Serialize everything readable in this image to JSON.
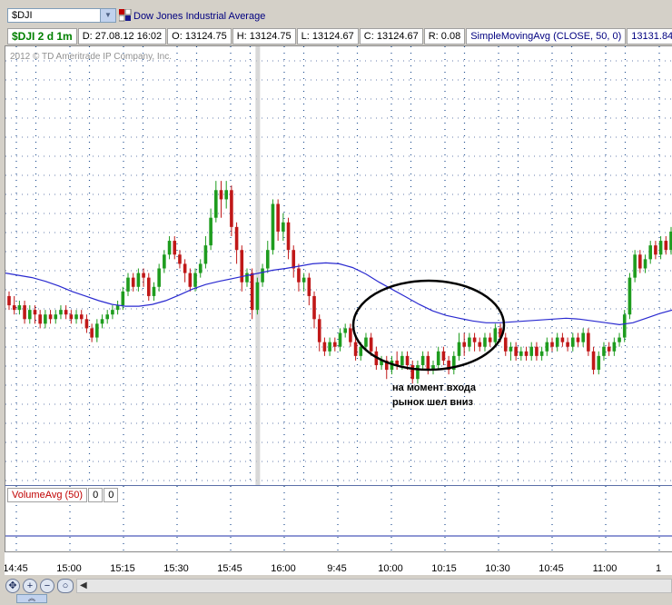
{
  "toolbar": {
    "symbol": "$DJI",
    "description": "Dow Jones Industrial Average"
  },
  "infobar": {
    "symbol_period": "$DJI 2 d 1m",
    "date": "D: 27.08.12 16:02",
    "open": "O: 13124.75",
    "high": "H: 13124.75",
    "low": "L: 13124.67",
    "close": "C: 13124.67",
    "range": "R: 0.08",
    "study_name": "SimpleMovingAvg (CLOSE, 50, 0)",
    "study_value": "13131.84"
  },
  "copyright": "2012 © TD Ameritrade IP Company, Inc.",
  "annotation": {
    "line1": "на момент входа",
    "line2": "рынок шел вниз"
  },
  "volume_panel": {
    "label": "VolumeAvg (50)",
    "v1": "0",
    "v2": "0"
  },
  "colors": {
    "up": "#1e9c1e",
    "down": "#c01818",
    "sma": "#2a2ad0",
    "grid": "#1f4e8f"
  },
  "chart_data": {
    "type": "candlestick",
    "series": [
      {
        "name": "$DJI 2 d 1m",
        "type": "candlestick"
      },
      {
        "name": "SimpleMovingAvg (CLOSE, 50, 0)",
        "type": "line"
      }
    ],
    "x_ticks": [
      "14:45",
      "15:00",
      "15:15",
      "15:30",
      "15:45",
      "16:00",
      "9:45",
      "10:00",
      "10:15",
      "10:30",
      "10:45",
      "11:00",
      "1"
    ],
    "candles": [
      {
        "o": 0.43,
        "c": 0.41,
        "h": 0.44,
        "l": 0.4
      },
      {
        "o": 0.41,
        "c": 0.4,
        "h": 0.43,
        "l": 0.39
      },
      {
        "o": 0.4,
        "c": 0.41,
        "h": 0.42,
        "l": 0.39
      },
      {
        "o": 0.41,
        "c": 0.38,
        "h": 0.42,
        "l": 0.37
      },
      {
        "o": 0.38,
        "c": 0.4,
        "h": 0.41,
        "l": 0.37
      },
      {
        "o": 0.4,
        "c": 0.39,
        "h": 0.41,
        "l": 0.37
      },
      {
        "o": 0.39,
        "c": 0.37,
        "h": 0.4,
        "l": 0.36
      },
      {
        "o": 0.37,
        "c": 0.39,
        "h": 0.4,
        "l": 0.36
      },
      {
        "o": 0.39,
        "c": 0.38,
        "h": 0.4,
        "l": 0.37
      },
      {
        "o": 0.38,
        "c": 0.39,
        "h": 0.4,
        "l": 0.37
      },
      {
        "o": 0.39,
        "c": 0.4,
        "h": 0.41,
        "l": 0.38
      },
      {
        "o": 0.4,
        "c": 0.39,
        "h": 0.41,
        "l": 0.38
      },
      {
        "o": 0.39,
        "c": 0.38,
        "h": 0.4,
        "l": 0.37
      },
      {
        "o": 0.38,
        "c": 0.39,
        "h": 0.4,
        "l": 0.37
      },
      {
        "o": 0.39,
        "c": 0.38,
        "h": 0.4,
        "l": 0.37
      },
      {
        "o": 0.38,
        "c": 0.36,
        "h": 0.39,
        "l": 0.35
      },
      {
        "o": 0.36,
        "c": 0.34,
        "h": 0.37,
        "l": 0.33
      },
      {
        "o": 0.34,
        "c": 0.37,
        "h": 0.38,
        "l": 0.33
      },
      {
        "o": 0.37,
        "c": 0.38,
        "h": 0.39,
        "l": 0.36
      },
      {
        "o": 0.38,
        "c": 0.39,
        "h": 0.4,
        "l": 0.37
      },
      {
        "o": 0.39,
        "c": 0.4,
        "h": 0.41,
        "l": 0.38
      },
      {
        "o": 0.4,
        "c": 0.41,
        "h": 0.42,
        "l": 0.39
      },
      {
        "o": 0.41,
        "c": 0.44,
        "h": 0.45,
        "l": 0.4
      },
      {
        "o": 0.44,
        "c": 0.47,
        "h": 0.48,
        "l": 0.43
      },
      {
        "o": 0.47,
        "c": 0.45,
        "h": 0.48,
        "l": 0.44
      },
      {
        "o": 0.45,
        "c": 0.48,
        "h": 0.49,
        "l": 0.44
      },
      {
        "o": 0.48,
        "c": 0.47,
        "h": 0.49,
        "l": 0.45
      },
      {
        "o": 0.47,
        "c": 0.43,
        "h": 0.48,
        "l": 0.42
      },
      {
        "o": 0.43,
        "c": 0.45,
        "h": 0.46,
        "l": 0.42
      },
      {
        "o": 0.45,
        "c": 0.49,
        "h": 0.5,
        "l": 0.44
      },
      {
        "o": 0.49,
        "c": 0.52,
        "h": 0.53,
        "l": 0.48
      },
      {
        "o": 0.52,
        "c": 0.55,
        "h": 0.56,
        "l": 0.51
      },
      {
        "o": 0.55,
        "c": 0.52,
        "h": 0.56,
        "l": 0.51
      },
      {
        "o": 0.52,
        "c": 0.5,
        "h": 0.53,
        "l": 0.49
      },
      {
        "o": 0.5,
        "c": 0.48,
        "h": 0.51,
        "l": 0.46
      },
      {
        "o": 0.48,
        "c": 0.45,
        "h": 0.49,
        "l": 0.44
      },
      {
        "o": 0.45,
        "c": 0.48,
        "h": 0.49,
        "l": 0.44
      },
      {
        "o": 0.48,
        "c": 0.5,
        "h": 0.51,
        "l": 0.47
      },
      {
        "o": 0.5,
        "c": 0.54,
        "h": 0.56,
        "l": 0.49
      },
      {
        "o": 0.54,
        "c": 0.6,
        "h": 0.62,
        "l": 0.53
      },
      {
        "o": 0.6,
        "c": 0.66,
        "h": 0.68,
        "l": 0.59
      },
      {
        "o": 0.66,
        "c": 0.64,
        "h": 0.68,
        "l": 0.6
      },
      {
        "o": 0.64,
        "c": 0.66,
        "h": 0.68,
        "l": 0.62
      },
      {
        "o": 0.66,
        "c": 0.58,
        "h": 0.67,
        "l": 0.56
      },
      {
        "o": 0.58,
        "c": 0.53,
        "h": 0.59,
        "l": 0.5
      },
      {
        "o": 0.53,
        "c": 0.46,
        "h": 0.54,
        "l": 0.44
      },
      {
        "o": 0.46,
        "c": 0.48,
        "h": 0.49,
        "l": 0.45
      },
      {
        "o": 0.48,
        "c": 0.4,
        "h": 0.49,
        "l": 0.38
      },
      {
        "o": 0.4,
        "c": 0.46,
        "h": 0.47,
        "l": 0.39
      },
      {
        "o": 0.46,
        "c": 0.49,
        "h": 0.5,
        "l": 0.45
      },
      {
        "o": 0.49,
        "c": 0.53,
        "h": 0.55,
        "l": 0.48
      },
      {
        "o": 0.53,
        "c": 0.63,
        "h": 0.64,
        "l": 0.52
      },
      {
        "o": 0.63,
        "c": 0.57,
        "h": 0.64,
        "l": 0.55
      },
      {
        "o": 0.57,
        "c": 0.59,
        "h": 0.61,
        "l": 0.55
      },
      {
        "o": 0.59,
        "c": 0.53,
        "h": 0.6,
        "l": 0.51
      },
      {
        "o": 0.53,
        "c": 0.49,
        "h": 0.54,
        "l": 0.47
      },
      {
        "o": 0.49,
        "c": 0.46,
        "h": 0.5,
        "l": 0.44
      },
      {
        "o": 0.46,
        "c": 0.47,
        "h": 0.48,
        "l": 0.44
      },
      {
        "o": 0.47,
        "c": 0.43,
        "h": 0.48,
        "l": 0.41
      },
      {
        "o": 0.43,
        "c": 0.38,
        "h": 0.44,
        "l": 0.36
      },
      {
        "o": 0.38,
        "c": 0.33,
        "h": 0.39,
        "l": 0.31
      },
      {
        "o": 0.33,
        "c": 0.31,
        "h": 0.34,
        "l": 0.3
      },
      {
        "o": 0.31,
        "c": 0.33,
        "h": 0.34,
        "l": 0.3
      },
      {
        "o": 0.33,
        "c": 0.32,
        "h": 0.34,
        "l": 0.31
      },
      {
        "o": 0.32,
        "c": 0.35,
        "h": 0.36,
        "l": 0.31
      },
      {
        "o": 0.35,
        "c": 0.36,
        "h": 0.37,
        "l": 0.34
      },
      {
        "o": 0.36,
        "c": 0.33,
        "h": 0.37,
        "l": 0.32
      },
      {
        "o": 0.33,
        "c": 0.3,
        "h": 0.34,
        "l": 0.29
      },
      {
        "o": 0.3,
        "c": 0.32,
        "h": 0.33,
        "l": 0.29
      },
      {
        "o": 0.32,
        "c": 0.34,
        "h": 0.35,
        "l": 0.31
      },
      {
        "o": 0.34,
        "c": 0.31,
        "h": 0.35,
        "l": 0.3
      },
      {
        "o": 0.31,
        "c": 0.28,
        "h": 0.32,
        "l": 0.27
      },
      {
        "o": 0.28,
        "c": 0.29,
        "h": 0.3,
        "l": 0.27
      },
      {
        "o": 0.29,
        "c": 0.27,
        "h": 0.3,
        "l": 0.25
      },
      {
        "o": 0.27,
        "c": 0.29,
        "h": 0.3,
        "l": 0.26
      },
      {
        "o": 0.29,
        "c": 0.28,
        "h": 0.31,
        "l": 0.27
      },
      {
        "o": 0.28,
        "c": 0.3,
        "h": 0.31,
        "l": 0.27
      },
      {
        "o": 0.3,
        "c": 0.28,
        "h": 0.31,
        "l": 0.27
      },
      {
        "o": 0.28,
        "c": 0.25,
        "h": 0.29,
        "l": 0.24
      },
      {
        "o": 0.25,
        "c": 0.28,
        "h": 0.29,
        "l": 0.24
      },
      {
        "o": 0.28,
        "c": 0.3,
        "h": 0.31,
        "l": 0.27
      },
      {
        "o": 0.3,
        "c": 0.27,
        "h": 0.31,
        "l": 0.26
      },
      {
        "o": 0.27,
        "c": 0.28,
        "h": 0.29,
        "l": 0.26
      },
      {
        "o": 0.28,
        "c": 0.31,
        "h": 0.32,
        "l": 0.27
      },
      {
        "o": 0.31,
        "c": 0.29,
        "h": 0.32,
        "l": 0.28
      },
      {
        "o": 0.29,
        "c": 0.27,
        "h": 0.3,
        "l": 0.26
      },
      {
        "o": 0.27,
        "c": 0.3,
        "h": 0.31,
        "l": 0.26
      },
      {
        "o": 0.3,
        "c": 0.33,
        "h": 0.35,
        "l": 0.29
      },
      {
        "o": 0.33,
        "c": 0.32,
        "h": 0.35,
        "l": 0.3
      },
      {
        "o": 0.32,
        "c": 0.34,
        "h": 0.35,
        "l": 0.31
      },
      {
        "o": 0.34,
        "c": 0.33,
        "h": 0.35,
        "l": 0.31
      },
      {
        "o": 0.33,
        "c": 0.32,
        "h": 0.34,
        "l": 0.31
      },
      {
        "o": 0.32,
        "c": 0.34,
        "h": 0.35,
        "l": 0.31
      },
      {
        "o": 0.34,
        "c": 0.33,
        "h": 0.35,
        "l": 0.32
      },
      {
        "o": 0.33,
        "c": 0.36,
        "h": 0.37,
        "l": 0.32
      },
      {
        "o": 0.36,
        "c": 0.34,
        "h": 0.37,
        "l": 0.33
      },
      {
        "o": 0.34,
        "c": 0.31,
        "h": 0.35,
        "l": 0.3
      },
      {
        "o": 0.31,
        "c": 0.32,
        "h": 0.33,
        "l": 0.29
      },
      {
        "o": 0.32,
        "c": 0.3,
        "h": 0.33,
        "l": 0.29
      },
      {
        "o": 0.3,
        "c": 0.31,
        "h": 0.32,
        "l": 0.29
      },
      {
        "o": 0.31,
        "c": 0.3,
        "h": 0.32,
        "l": 0.29
      },
      {
        "o": 0.3,
        "c": 0.32,
        "h": 0.33,
        "l": 0.29
      },
      {
        "o": 0.32,
        "c": 0.3,
        "h": 0.33,
        "l": 0.29
      },
      {
        "o": 0.3,
        "c": 0.31,
        "h": 0.32,
        "l": 0.29
      },
      {
        "o": 0.31,
        "c": 0.33,
        "h": 0.34,
        "l": 0.3
      },
      {
        "o": 0.33,
        "c": 0.32,
        "h": 0.34,
        "l": 0.31
      },
      {
        "o": 0.32,
        "c": 0.34,
        "h": 0.35,
        "l": 0.31
      },
      {
        "o": 0.34,
        "c": 0.33,
        "h": 0.35,
        "l": 0.32
      },
      {
        "o": 0.33,
        "c": 0.32,
        "h": 0.34,
        "l": 0.31
      },
      {
        "o": 0.32,
        "c": 0.34,
        "h": 0.35,
        "l": 0.31
      },
      {
        "o": 0.34,
        "c": 0.33,
        "h": 0.35,
        "l": 0.32
      },
      {
        "o": 0.33,
        "c": 0.35,
        "h": 0.36,
        "l": 0.32
      },
      {
        "o": 0.35,
        "c": 0.31,
        "h": 0.36,
        "l": 0.3
      },
      {
        "o": 0.31,
        "c": 0.27,
        "h": 0.32,
        "l": 0.26
      },
      {
        "o": 0.27,
        "c": 0.3,
        "h": 0.31,
        "l": 0.26
      },
      {
        "o": 0.3,
        "c": 0.32,
        "h": 0.33,
        "l": 0.29
      },
      {
        "o": 0.32,
        "c": 0.31,
        "h": 0.33,
        "l": 0.3
      },
      {
        "o": 0.31,
        "c": 0.33,
        "h": 0.34,
        "l": 0.3
      },
      {
        "o": 0.33,
        "c": 0.34,
        "h": 0.35,
        "l": 0.32
      },
      {
        "o": 0.34,
        "c": 0.39,
        "h": 0.4,
        "l": 0.33
      },
      {
        "o": 0.39,
        "c": 0.47,
        "h": 0.48,
        "l": 0.38
      },
      {
        "o": 0.47,
        "c": 0.52,
        "h": 0.53,
        "l": 0.46
      },
      {
        "o": 0.52,
        "c": 0.49,
        "h": 0.53,
        "l": 0.48
      },
      {
        "o": 0.49,
        "c": 0.51,
        "h": 0.52,
        "l": 0.48
      },
      {
        "o": 0.51,
        "c": 0.54,
        "h": 0.55,
        "l": 0.5
      },
      {
        "o": 0.54,
        "c": 0.52,
        "h": 0.55,
        "l": 0.51
      },
      {
        "o": 0.52,
        "c": 0.55,
        "h": 0.56,
        "l": 0.51
      },
      {
        "o": 0.55,
        "c": 0.53,
        "h": 0.56,
        "l": 0.52
      },
      {
        "o": 0.53,
        "c": 0.57,
        "h": 0.58,
        "l": 0.52
      }
    ],
    "sma": [
      0.48,
      0.475,
      0.47,
      0.462,
      0.452,
      0.44,
      0.43,
      0.42,
      0.412,
      0.408,
      0.408,
      0.412,
      0.42,
      0.432,
      0.445,
      0.455,
      0.462,
      0.468,
      0.474,
      0.48,
      0.486,
      0.49,
      0.495,
      0.5,
      0.502,
      0.5,
      0.492,
      0.478,
      0.46,
      0.444,
      0.428,
      0.412,
      0.398,
      0.388,
      0.382,
      0.376,
      0.372,
      0.372,
      0.374,
      0.376,
      0.378,
      0.38,
      0.382,
      0.38,
      0.376,
      0.372,
      0.368,
      0.372,
      0.382,
      0.392,
      0.4
    ],
    "vertical_marker_index": 48,
    "circle_highlight": {
      "from_index": 65,
      "to_index": 107
    }
  }
}
